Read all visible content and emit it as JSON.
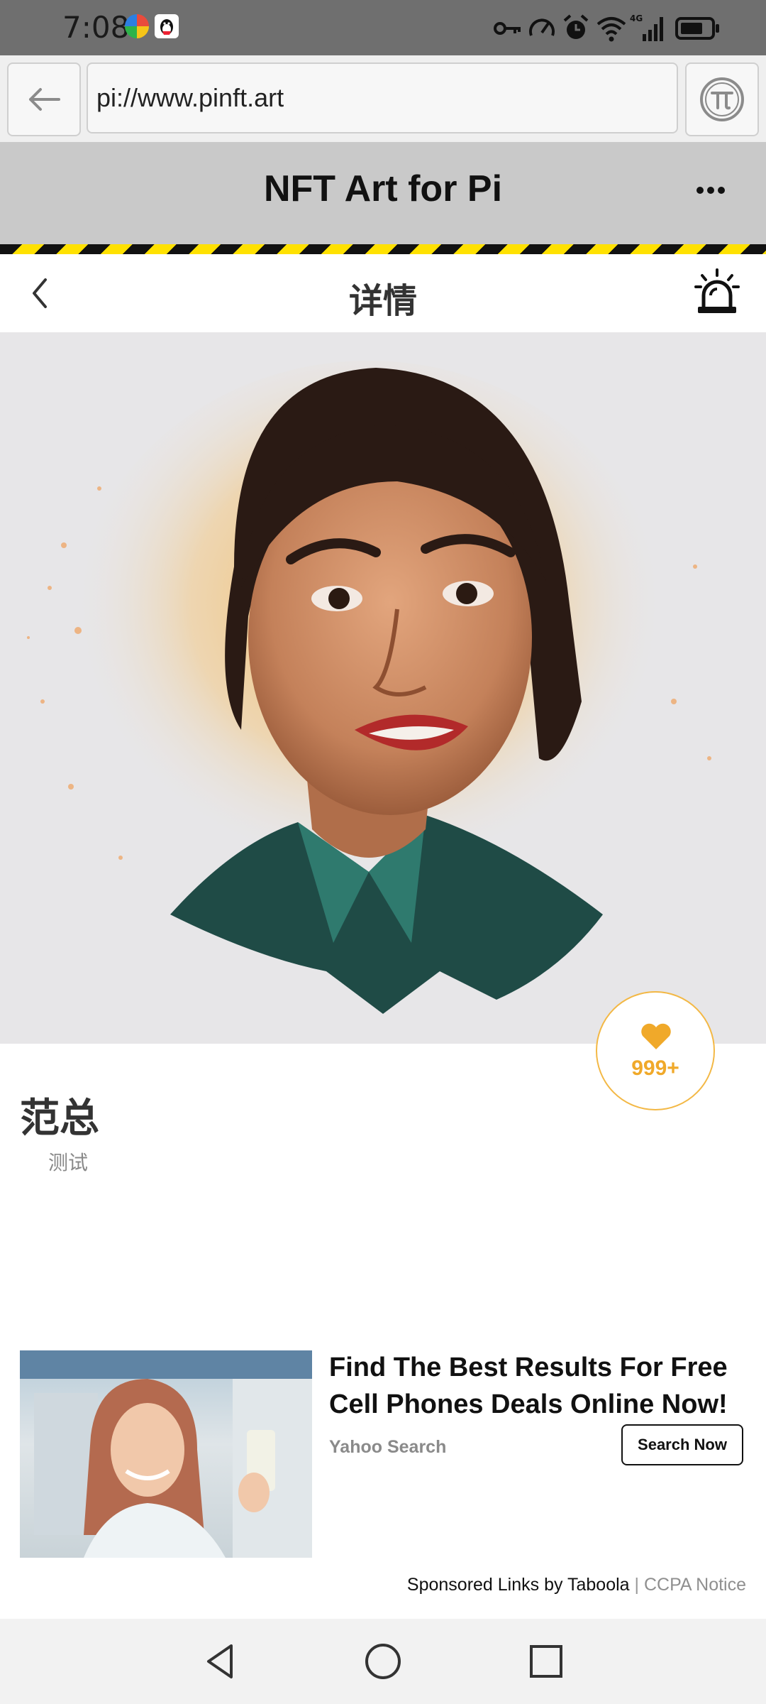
{
  "status_bar": {
    "time": "7:08",
    "app_icons": [
      "multicolor-app-icon",
      "qq-penguin-icon"
    ],
    "icons": [
      "key-icon",
      "speedometer-icon",
      "alarm-icon",
      "wifi-icon",
      "4g-signal-icon",
      "battery-icon"
    ],
    "network_label": "4G"
  },
  "browser": {
    "url": "pi://www.pinft.art",
    "back_icon": "arrow-left-icon",
    "pi_icon": "pi-logo-icon"
  },
  "site": {
    "title": "NFT Art for Pi",
    "menu_icon": "more-dots-icon"
  },
  "detail": {
    "title": "详情",
    "back_icon": "chevron-left-icon",
    "alarm_icon": "siren-alarm-icon"
  },
  "item": {
    "name": "范总",
    "subtitle": "测试",
    "likes": "999+",
    "like_icon": "heart-icon",
    "artwork": "painted portrait of a smiling woman"
  },
  "ad": {
    "title": "Find The Best Results For Free Cell Phones Deals Online Now!",
    "source": "Yahoo Search",
    "cta": "Search Now",
    "sponsor_text": "Sponsored Links by Taboola",
    "separator": "|",
    "ccpa": "CCPA Notice"
  },
  "system_nav": [
    "back-triangle-icon",
    "home-circle-icon",
    "recents-square-icon"
  ],
  "colors": {
    "accent": "#f0a92a",
    "header_bg": "#c9c9c9",
    "hazard_yellow": "#ffe100"
  }
}
